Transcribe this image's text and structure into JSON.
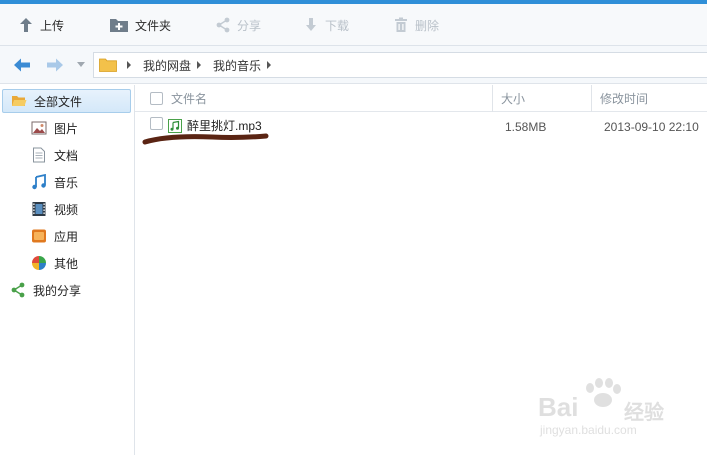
{
  "toolbar": {
    "upload": "上传",
    "new_folder": "文件夹",
    "share": "分享",
    "download": "下载",
    "delete": "删除"
  },
  "breadcrumb": [
    "我的网盘",
    "我的音乐"
  ],
  "sidebar": {
    "items": [
      {
        "label": "全部文件",
        "icon": "folder-open-icon"
      },
      {
        "label": "图片",
        "icon": "picture-icon"
      },
      {
        "label": "文档",
        "icon": "document-icon"
      },
      {
        "label": "音乐",
        "icon": "music-note-icon"
      },
      {
        "label": "视频",
        "icon": "film-icon"
      },
      {
        "label": "应用",
        "icon": "app-icon"
      },
      {
        "label": "其他",
        "icon": "other-icon"
      },
      {
        "label": "我的分享",
        "icon": "share-icon"
      }
    ]
  },
  "list": {
    "headers": {
      "name": "文件名",
      "size": "大小",
      "modified": "修改时间"
    },
    "rows": [
      {
        "name": "醉里挑灯.mp3",
        "size": "1.58MB",
        "modified": "2013-09-10 22:10"
      }
    ]
  },
  "watermark": {
    "brand_a": "Bai",
    "brand_b": "经验",
    "url": "jingyan.baidu.com"
  },
  "colors": {
    "accent": "#2f8fd8",
    "active_bg": "#d4e8f9",
    "scribble": "#5a2413"
  }
}
